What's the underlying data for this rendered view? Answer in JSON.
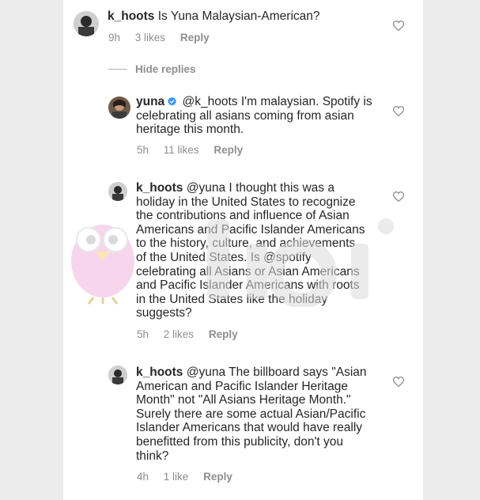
{
  "comments": [
    {
      "username": "k_hoots",
      "text": "Is Yuna Malaysian-American?",
      "time": "9h",
      "likes": "3 likes",
      "reply_label": "Reply"
    },
    {
      "username": "yuna",
      "mention": "@k_hoots",
      "text_lines": [
        "I'm malaysian. Spotify is",
        "celebrating all asians coming from asian",
        "heritage this month."
      ],
      "time": "5h",
      "likes": "11 likes",
      "reply_label": "Reply"
    },
    {
      "username": "k_hoots",
      "mention": "@yuna",
      "text_lines": [
        "I thought this was a",
        "holiday in the United States to recognize",
        "the contributions and influence of Asian",
        "Americans and Pacific Islander Americans",
        "to the history, culture, and achievements",
        "of the United States. Is @spotify",
        "celebrating all Asians or Asian Americans",
        "and Pacific Islander Americans with roots",
        "in the United States like the holiday",
        "suggests?"
      ],
      "time": "5h",
      "likes": "2 likes",
      "reply_label": "Reply"
    },
    {
      "username": "k_hoots",
      "mention": "@yuna",
      "text_lines": [
        "The billboard says \"Asian",
        "American and Pacific Islander Heritage",
        "Month\" not \"All Asians Heritage Month.\"",
        "Surely there are some actual Asian/Pacific",
        "Islander Americans that would have really",
        "benefitted from this publicity, don't you",
        "think?"
      ],
      "time": "4h",
      "likes": "1 like",
      "reply_label": "Reply"
    }
  ],
  "hide_replies_label": "Hide replies",
  "icons": {
    "heart": "heart-outline-icon",
    "verified": "verified-badge-icon"
  },
  "colors": {
    "text": "#262626",
    "meta": "#8e8e8e",
    "verified": "#3897f0"
  }
}
